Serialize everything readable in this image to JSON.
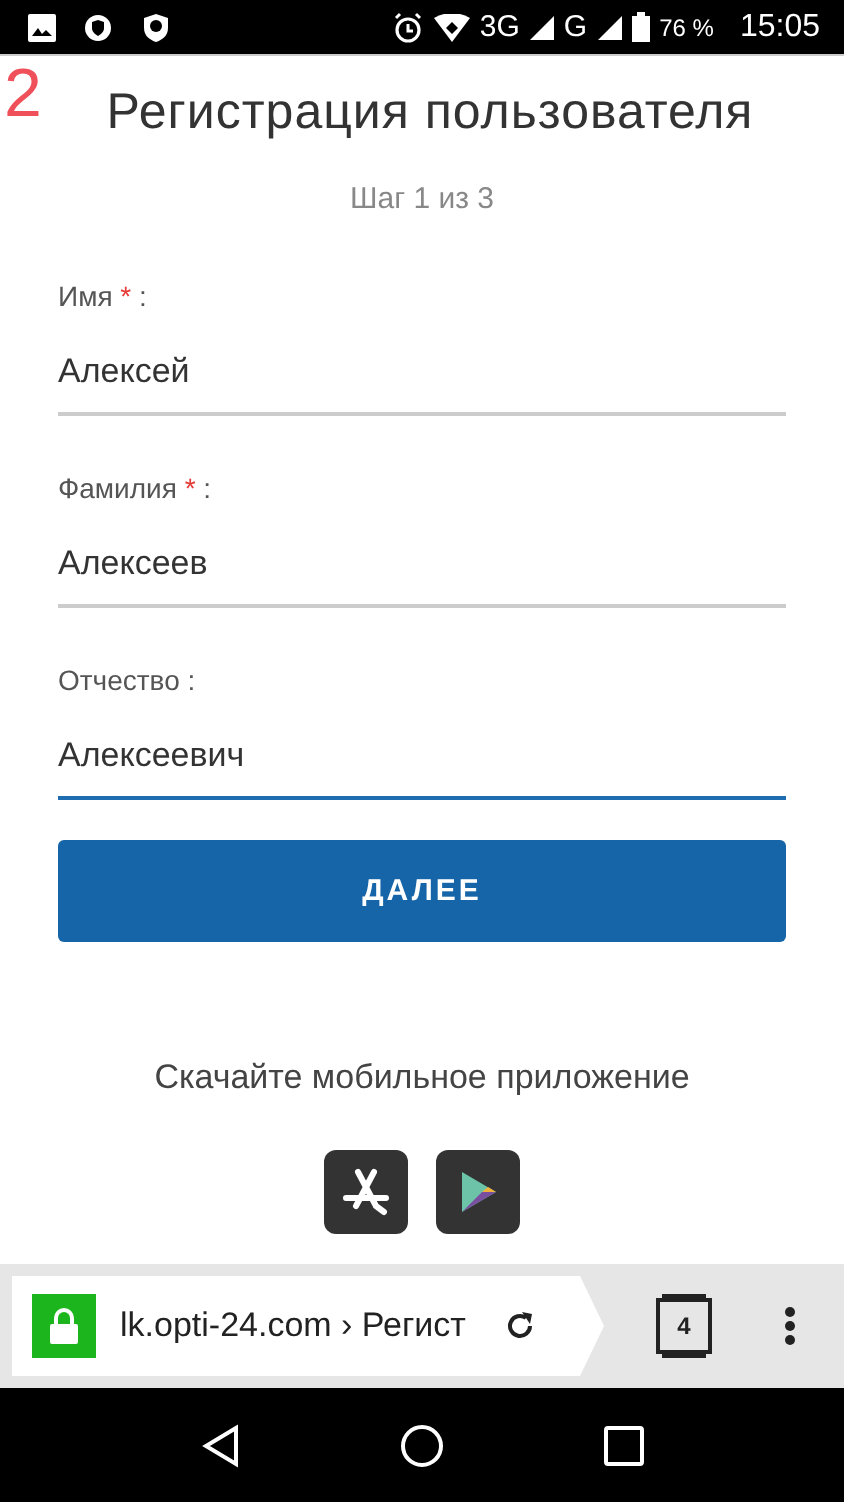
{
  "status_bar": {
    "battery": "76 %",
    "time": "15:05",
    "network_1": "3G",
    "network_2": "G"
  },
  "step_marker": "2",
  "title": "Регистрация пользователя",
  "step": "Шаг 1 из 3",
  "fields": [
    {
      "label": "Имя",
      "required_mark": "*",
      "colon": ":",
      "value": "Алексей",
      "focused": false
    },
    {
      "label": "Фамилия",
      "required_mark": "*",
      "colon": ":",
      "value": "Алексеев",
      "focused": false
    },
    {
      "label": "Отчество",
      "colon": ":",
      "value": "Алексеевич",
      "focused": true
    }
  ],
  "next_button": "ДАЛЕЕ",
  "app_prompt": "Скачайте мобильное приложение",
  "browser": {
    "url": "lk.opti-24.com › Регист",
    "tabs_count": "4"
  }
}
